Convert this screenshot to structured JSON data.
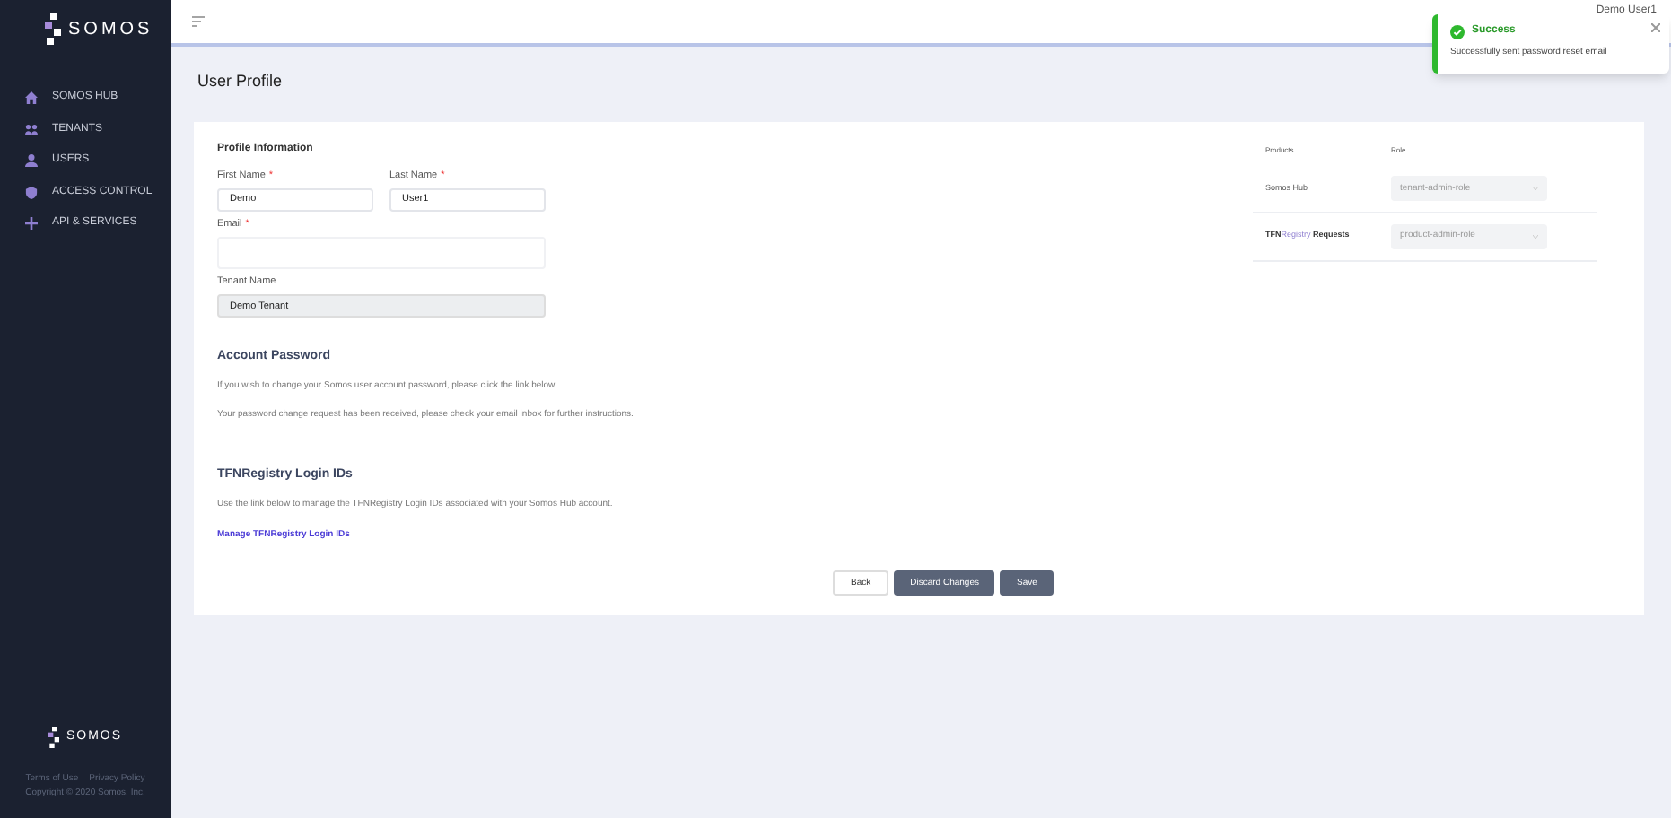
{
  "sidebar": {
    "logo": "SOMOS",
    "nav": [
      {
        "label": "SOMOS HUB",
        "selected": false
      },
      {
        "label": "TENANTS",
        "selected": false
      },
      {
        "label": "USERS",
        "selected": false
      },
      {
        "label": "ACCESS CONTROL",
        "selected": false
      },
      {
        "label": "API & SERVICES",
        "selected": false
      }
    ],
    "footer_logo": "SOMOS",
    "footer_links": [
      "Terms of Use",
      "Privacy Policy"
    ],
    "copyright": "Copyright © 2020 Somos, Inc."
  },
  "header": {
    "user": "Demo User1"
  },
  "page_title": "User Profile",
  "profile": {
    "heading": "Profile Information",
    "fields": [
      {
        "label": "First Name",
        "required_mark": "*",
        "value": "Demo",
        "disabled": false
      },
      {
        "label": "Last Name",
        "required_mark": "*",
        "value": "User1",
        "disabled": false
      },
      {
        "label": "Email",
        "required_mark": "*",
        "disabled": false
      },
      {
        "label": "Tenant Name",
        "value": "Demo Tenant",
        "disabled": true
      }
    ]
  },
  "roles": {
    "columns": [
      "Products",
      "Role"
    ],
    "rows": [
      {
        "product": [
          "Somos Hub"
        ],
        "role": "tenant-admin-role"
      },
      {
        "product": [
          "TFN",
          "Registry",
          "Requests"
        ],
        "role": "product-admin-role"
      }
    ]
  },
  "password": {
    "heading": "Account Password",
    "text": "If you wish to change your Somos user account password, please click the link below",
    "notice": "Your password change request has been received, please check your email inbox for further instructions."
  },
  "login_ids": {
    "heading": "TFNRegistry Login IDs",
    "text": "Use the link below to manage the TFNRegistry Login IDs associated with your Somos Hub account.",
    "link": "Manage TFNRegistry Login IDs"
  },
  "buttons": [
    {
      "label": "Back",
      "kind": "secondary"
    },
    {
      "label": "Discard Changes",
      "kind": "primary"
    },
    {
      "label": "Save",
      "kind": "primary"
    }
  ],
  "toast": {
    "title": "Success",
    "message": "Successfully sent password reset email"
  }
}
